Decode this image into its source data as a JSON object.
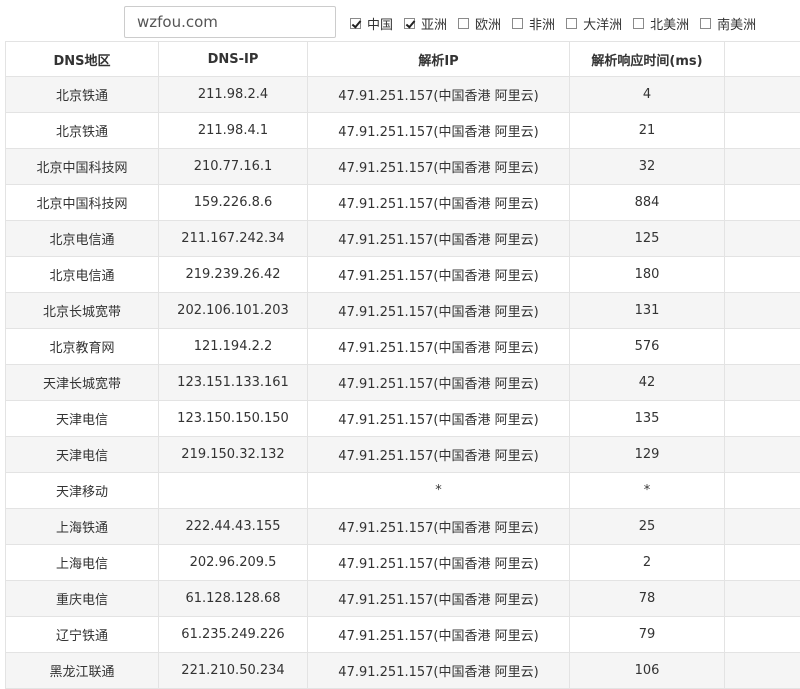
{
  "search": {
    "domain": "wzfou.com"
  },
  "filters": [
    {
      "label": "中国",
      "checked": true
    },
    {
      "label": "亚洲",
      "checked": true
    },
    {
      "label": "欧洲",
      "checked": false
    },
    {
      "label": "非洲",
      "checked": false
    },
    {
      "label": "大洋洲",
      "checked": false
    },
    {
      "label": "北美洲",
      "checked": false
    },
    {
      "label": "南美洲",
      "checked": false
    }
  ],
  "table": {
    "headers": [
      "DNS地区",
      "DNS-IP",
      "解析IP",
      "解析响应时间(ms)",
      ""
    ],
    "rows": [
      [
        "北京铁通",
        "211.98.2.4",
        "47.91.251.157(中国香港 阿里云)",
        "4"
      ],
      [
        "北京铁通",
        "211.98.4.1",
        "47.91.251.157(中国香港 阿里云)",
        "21"
      ],
      [
        "北京中国科技网",
        "210.77.16.1",
        "47.91.251.157(中国香港 阿里云)",
        "32"
      ],
      [
        "北京中国科技网",
        "159.226.8.6",
        "47.91.251.157(中国香港 阿里云)",
        "884"
      ],
      [
        "北京电信通",
        "211.167.242.34",
        "47.91.251.157(中国香港 阿里云)",
        "125"
      ],
      [
        "北京电信通",
        "219.239.26.42",
        "47.91.251.157(中国香港 阿里云)",
        "180"
      ],
      [
        "北京长城宽带",
        "202.106.101.203",
        "47.91.251.157(中国香港 阿里云)",
        "131"
      ],
      [
        "北京教育网",
        "121.194.2.2",
        "47.91.251.157(中国香港 阿里云)",
        "576"
      ],
      [
        "天津长城宽带",
        "123.151.133.161",
        "47.91.251.157(中国香港 阿里云)",
        "42"
      ],
      [
        "天津电信",
        "123.150.150.150",
        "47.91.251.157(中国香港 阿里云)",
        "135"
      ],
      [
        "天津电信",
        "219.150.32.132",
        "47.91.251.157(中国香港 阿里云)",
        "129"
      ],
      [
        "天津移动",
        "",
        "*",
        "*"
      ],
      [
        "上海铁通",
        "222.44.43.155",
        "47.91.251.157(中国香港 阿里云)",
        "25"
      ],
      [
        "上海电信",
        "202.96.209.5",
        "47.91.251.157(中国香港 阿里云)",
        "2"
      ],
      [
        "重庆电信",
        "61.128.128.68",
        "47.91.251.157(中国香港 阿里云)",
        "78"
      ],
      [
        "辽宁铁通",
        "61.235.249.226",
        "47.91.251.157(中国香港 阿里云)",
        "79"
      ],
      [
        "黑龙江联通",
        "221.210.50.234",
        "47.91.251.157(中国香港 阿里云)",
        "106"
      ]
    ]
  }
}
